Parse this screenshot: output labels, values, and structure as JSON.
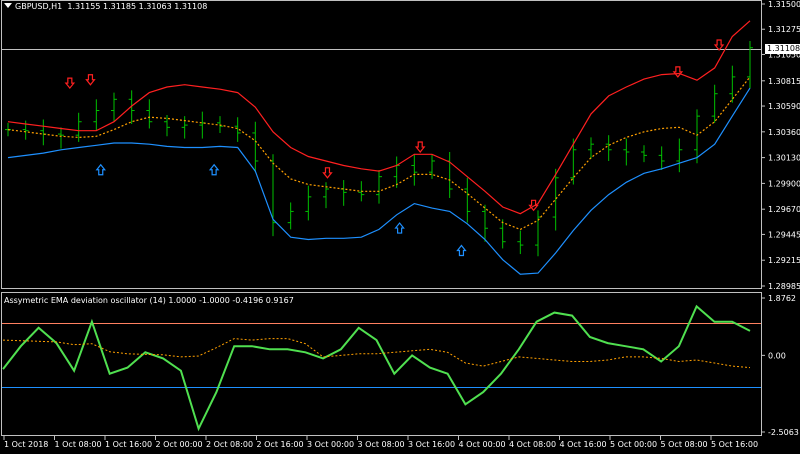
{
  "header": {
    "symbol": "GBPUSD,H1",
    "ohlc": "1.31155 1.31185 1.31063 1.31108"
  },
  "oscillator": {
    "title": "Assymetric EMA deviation oscillator (14) 1.0000 -1.0000 -0.4196 0.9167"
  },
  "current_price_label": "1.31108",
  "colors": {
    "background": "#000000",
    "candle": "#00c000",
    "upper_band": "#ff2020",
    "middle_band": "#ffa000",
    "lower_band": "#1e90ff",
    "oscillator": "#50e050",
    "osc_signal": "#ffa000",
    "osc_upper_level": "#ff8060",
    "osc_lower_level": "#1e90ff",
    "sell_arrow": "#ff2020",
    "buy_arrow": "#1e90ff",
    "grid": "#c0c0c0"
  },
  "price_axis": {
    "ticks": [
      "1.31500",
      "1.31275",
      "1.31050",
      "1.30815",
      "1.30590",
      "1.30360",
      "1.30130",
      "1.29900",
      "1.29670",
      "1.29445",
      "1.29215",
      "1.28985"
    ],
    "ylim": [
      1.28985,
      1.315
    ]
  },
  "osc_axis": {
    "ticks": [
      "1.8762",
      "0.00",
      "-2.5063"
    ],
    "ylim": [
      -2.5063,
      1.8762
    ]
  },
  "time_axis": {
    "labels": [
      "1 Oct 2018",
      "1 Oct 08:00",
      "1 Oct 16:00",
      "2 Oct 00:00",
      "2 Oct 08:00",
      "2 Oct 16:00",
      "3 Oct 00:00",
      "3 Oct 08:00",
      "3 Oct 16:00",
      "4 Oct 00:00",
      "4 Oct 08:00",
      "4 Oct 16:00",
      "5 Oct 00:00",
      "5 Oct 08:00",
      "5 Oct 16:00"
    ]
  },
  "chart_data": [
    {
      "type": "line",
      "title": "GBPUSD,H1",
      "current_price": 1.31108,
      "series": [
        {
          "name": "upper",
          "values": [
            1.3045,
            1.3043,
            1.3041,
            1.3039,
            1.3037,
            1.3037,
            1.3045,
            1.3059,
            1.3071,
            1.3076,
            1.3078,
            1.3076,
            1.3074,
            1.3071,
            1.3058,
            1.3036,
            1.3022,
            1.3014,
            1.301,
            1.3006,
            1.3003,
            1.3001,
            1.3006,
            1.3016,
            1.3016,
            1.3009,
            1.2996,
            1.2983,
            1.2969,
            1.2963,
            1.2972,
            1.2998,
            1.3025,
            1.3052,
            1.3068,
            1.3076,
            1.3083,
            1.3087,
            1.3088,
            1.3082,
            1.3093,
            1.3121,
            1.3135
          ]
        },
        {
          "name": "middle",
          "values": [
            1.3038,
            1.3036,
            1.3034,
            1.3032,
            1.3031,
            1.3032,
            1.3038,
            1.3045,
            1.3049,
            1.3048,
            1.3046,
            1.3044,
            1.3042,
            1.3039,
            1.3028,
            1.3008,
            1.2994,
            1.2989,
            1.2987,
            1.2985,
            1.2983,
            1.2983,
            1.2989,
            1.2998,
            1.2998,
            1.2993,
            1.2981,
            1.2968,
            1.2955,
            1.2949,
            1.2957,
            1.2976,
            1.2995,
            1.3013,
            1.3024,
            1.3031,
            1.3036,
            1.3039,
            1.304,
            1.3033,
            1.3045,
            1.3065,
            1.3085
          ]
        },
        {
          "name": "lower",
          "values": [
            1.3013,
            1.3015,
            1.3017,
            1.302,
            1.3022,
            1.3024,
            1.3026,
            1.3026,
            1.3025,
            1.3023,
            1.3022,
            1.3022,
            1.3023,
            1.3022,
            1.3001,
            1.2958,
            1.2942,
            1.294,
            1.2941,
            1.2941,
            1.2942,
            1.2949,
            1.2962,
            1.2972,
            1.2968,
            1.2965,
            1.2954,
            1.294,
            1.2922,
            1.2909,
            1.291,
            1.2928,
            1.2948,
            1.2966,
            1.298,
            1.2991,
            1.2999,
            1.3003,
            1.3008,
            1.3013,
            1.3025,
            1.305,
            1.3075
          ]
        },
        {
          "name": "close",
          "values": [
            1.3038,
            1.3037,
            1.3034,
            1.3033,
            1.3045,
            1.3055,
            1.3065,
            1.3055,
            1.3045,
            1.304,
            1.3042,
            1.3044,
            1.3041,
            1.3035,
            1.301,
            1.2955,
            1.2965,
            1.2978,
            1.2985,
            1.2982,
            1.298,
            1.2996,
            1.3006,
            1.3,
            1.301,
            1.2985,
            1.2965,
            1.295,
            1.2938,
            1.2935,
            1.296,
            1.2995,
            1.302,
            1.3025,
            1.302,
            1.3018,
            1.3015,
            1.301,
            1.302,
            1.305,
            1.307,
            1.3085,
            1.3111
          ]
        }
      ],
      "sell_signals": [
        {
          "index": 6,
          "price": 1.3075
        },
        {
          "index": 8,
          "price": 1.3078
        },
        {
          "index": 31,
          "price": 1.2995
        },
        {
          "index": 40,
          "price": 1.3018
        },
        {
          "index": 51,
          "price": 1.2966
        },
        {
          "index": 65,
          "price": 1.3085
        },
        {
          "index": 69,
          "price": 1.3109
        }
      ],
      "buy_signals": [
        {
          "index": 9,
          "price": 1.3012
        },
        {
          "index": 20,
          "price": 1.3012
        },
        {
          "index": 38,
          "price": 1.296
        },
        {
          "index": 44,
          "price": 1.294
        }
      ]
    },
    {
      "type": "line",
      "title": "Assymetric EMA deviation oscillator (14) 1.0000 -1.0000 -0.4196 0.9167",
      "levels": [
        1.0,
        -1.0
      ],
      "ylim": [
        -2.5063,
        1.8762
      ],
      "series": [
        {
          "name": "oscillator",
          "values": [
            -0.45,
            0.3,
            0.9,
            0.4,
            -0.5,
            1.1,
            -0.6,
            -0.4,
            0.1,
            -0.1,
            -0.5,
            -2.4,
            -1.2,
            0.3,
            0.3,
            0.2,
            0.2,
            0.1,
            -0.1,
            0.2,
            0.9,
            0.5,
            -0.6,
            0.0,
            -0.4,
            -0.6,
            -1.6,
            -1.2,
            -0.6,
            0.2,
            1.1,
            1.4,
            1.3,
            0.6,
            0.4,
            0.3,
            0.2,
            -0.2,
            0.3,
            1.6,
            1.1,
            1.1,
            0.8
          ]
        },
        {
          "name": "signal",
          "values": [
            0.5,
            0.48,
            0.46,
            0.44,
            0.35,
            0.38,
            0.12,
            0.05,
            0.03,
            0.02,
            -0.05,
            -0.02,
            0.25,
            0.55,
            0.5,
            0.55,
            0.55,
            0.38,
            -0.05,
            0.0,
            0.05,
            0.05,
            0.1,
            0.15,
            0.2,
            0.1,
            -0.25,
            -0.35,
            -0.2,
            -0.05,
            -0.1,
            -0.15,
            -0.2,
            -0.2,
            -0.15,
            -0.05,
            -0.05,
            -0.1,
            -0.2,
            -0.15,
            -0.25,
            -0.35,
            -0.4
          ]
        }
      ]
    }
  ]
}
